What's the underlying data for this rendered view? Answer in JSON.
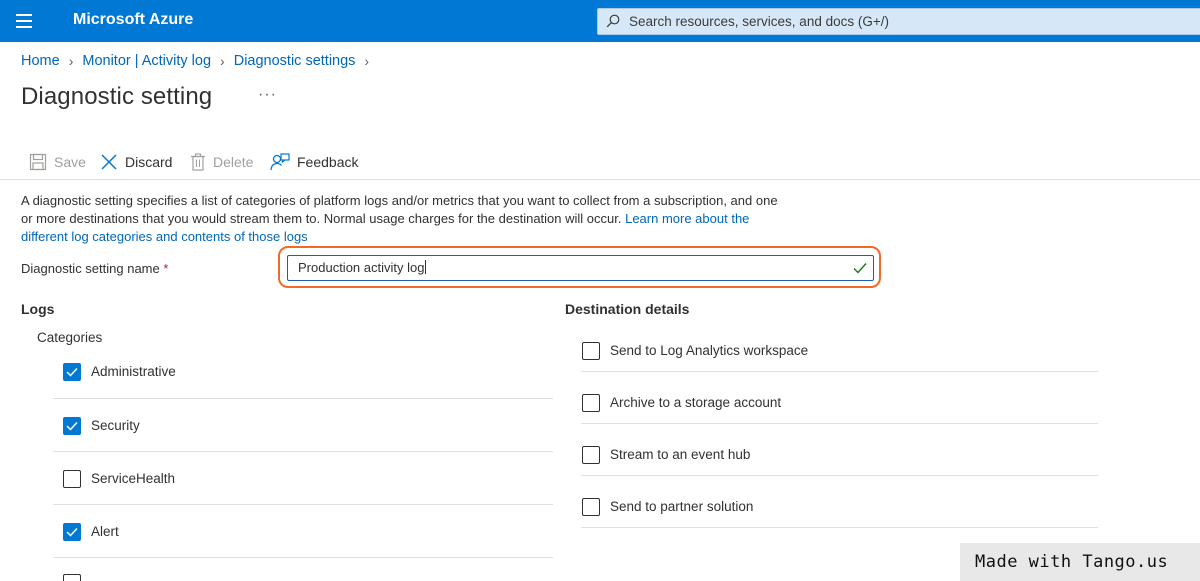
{
  "topbar": {
    "brand": "Microsoft Azure",
    "search_placeholder": "Search resources, services, and docs (G+/)"
  },
  "breadcrumb": [
    {
      "label": "Home"
    },
    {
      "label": "Monitor | Activity log"
    },
    {
      "label": "Diagnostic settings"
    }
  ],
  "page": {
    "title": "Diagnostic setting",
    "more": "···"
  },
  "commands": {
    "save": "Save",
    "discard": "Discard",
    "delete": "Delete",
    "feedback": "Feedback"
  },
  "description": {
    "text": "A diagnostic setting specifies a list of categories of platform logs and/or metrics that you want to collect from a subscription, and one or more destinations that you would stream them to. Normal usage charges for the destination will occur.",
    "link": "Learn more about the different log categories and contents of those logs"
  },
  "name_field": {
    "label": "Diagnostic setting name",
    "required_mark": "*",
    "value": "Production activity log"
  },
  "logs": {
    "heading": "Logs",
    "categories_label": "Categories",
    "items": [
      {
        "label": "Administrative",
        "checked": true
      },
      {
        "label": "Security",
        "checked": true
      },
      {
        "label": "ServiceHealth",
        "checked": false
      },
      {
        "label": "Alert",
        "checked": true
      }
    ]
  },
  "destination": {
    "heading": "Destination details",
    "items": [
      {
        "label": "Send to Log Analytics workspace",
        "checked": false
      },
      {
        "label": "Archive to a storage account",
        "checked": false
      },
      {
        "label": "Stream to an event hub",
        "checked": false
      },
      {
        "label": "Send to partner solution",
        "checked": false
      }
    ]
  },
  "watermark": "Made with Tango.us",
  "colors": {
    "azure_blue": "#0078d4",
    "link": "#0067b8",
    "highlight": "#f06a28",
    "valid_check": "#107c10"
  }
}
